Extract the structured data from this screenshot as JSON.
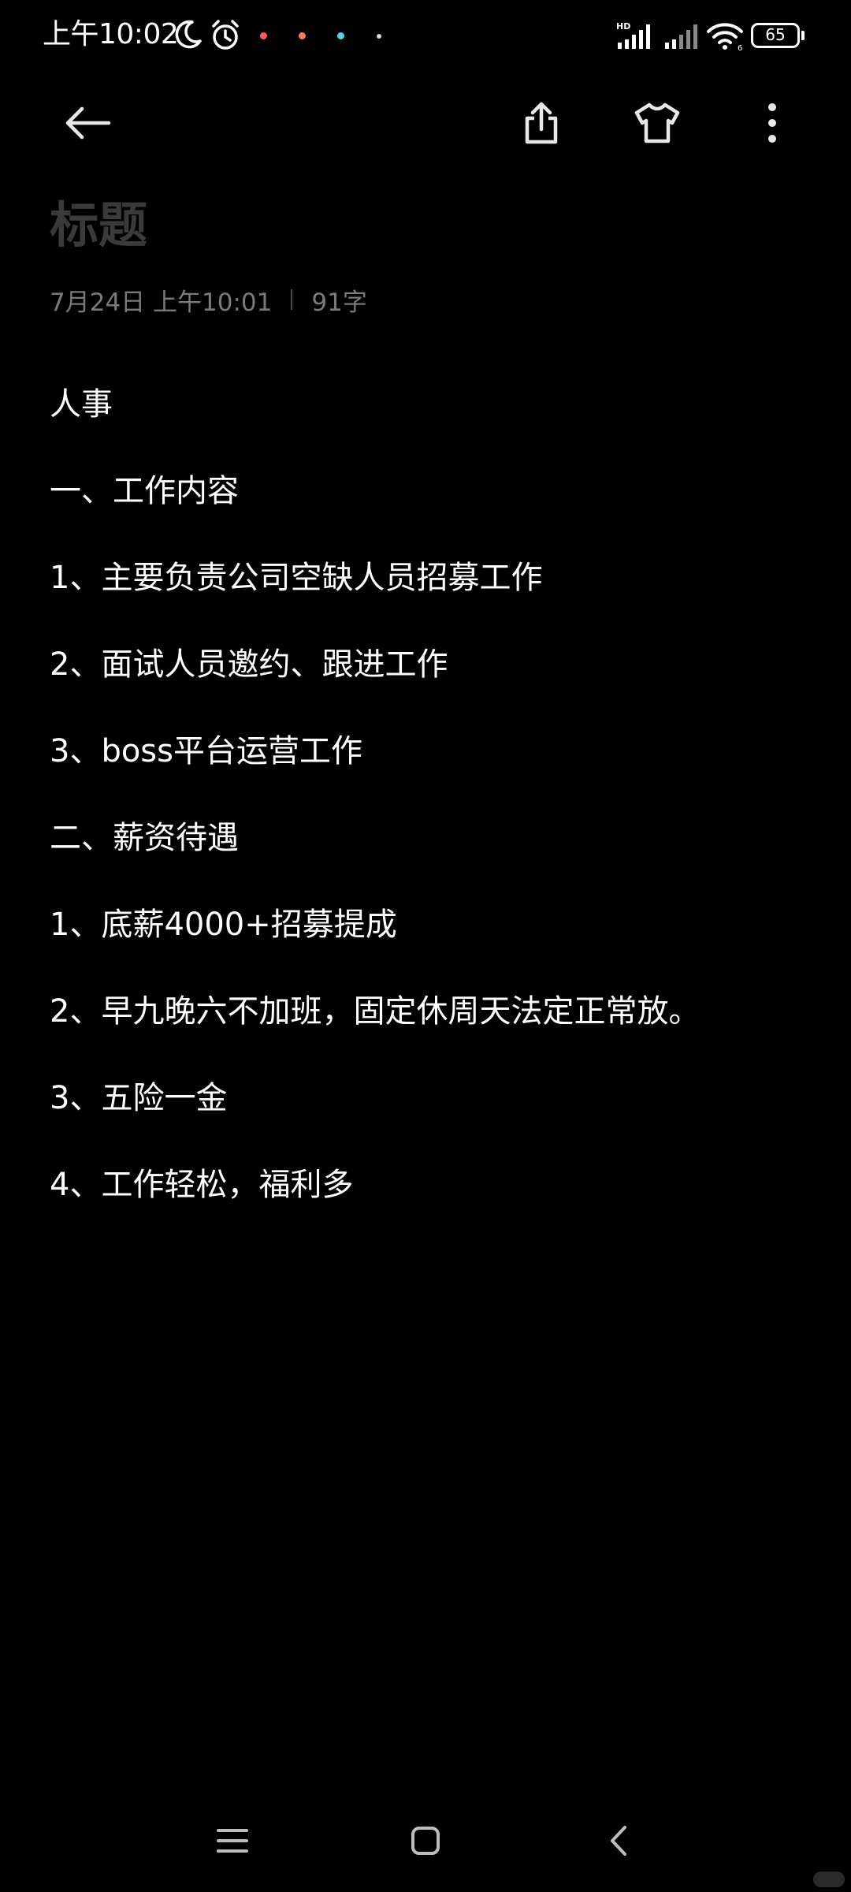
{
  "status_bar": {
    "time": "上午10:02",
    "battery_level": "65",
    "icons": [
      "moon-icon",
      "alarm-icon",
      "hd-icon",
      "signal-icon",
      "wifi-icon",
      "battery-icon"
    ],
    "notification_dot_colors": [
      "#ff5a5a",
      "#ff7a5a",
      "#5ad2e6",
      "#d8d8d8"
    ]
  },
  "toolbar": {
    "back_icon": "arrow-left-icon",
    "share_icon": "share-icon",
    "theme_icon": "tshirt-icon",
    "more_icon": "more-vertical-icon"
  },
  "note": {
    "title_placeholder": "标题",
    "date": "7月24日 上午10:01",
    "word_count": "91字",
    "lines": [
      "人事",
      "一、工作内容",
      "1、主要负责公司空缺人员招募工作",
      "2、面试人员邀约、跟进工作",
      "3、boss平台运营工作",
      "二、薪资待遇",
      "1、底薪4000+招募提成",
      "2、早九晚六不加班，固定休周天法定正常放。",
      "3、五险一金",
      "4、工作轻松，福利多"
    ]
  },
  "nav_bar": {
    "icons": [
      "menu-icon",
      "home-square-icon",
      "back-chevron-icon"
    ]
  },
  "colors": {
    "background": "#000000",
    "text": "#ffffff",
    "title_placeholder": "#3a3a3a",
    "meta": "#7a7a7a"
  }
}
